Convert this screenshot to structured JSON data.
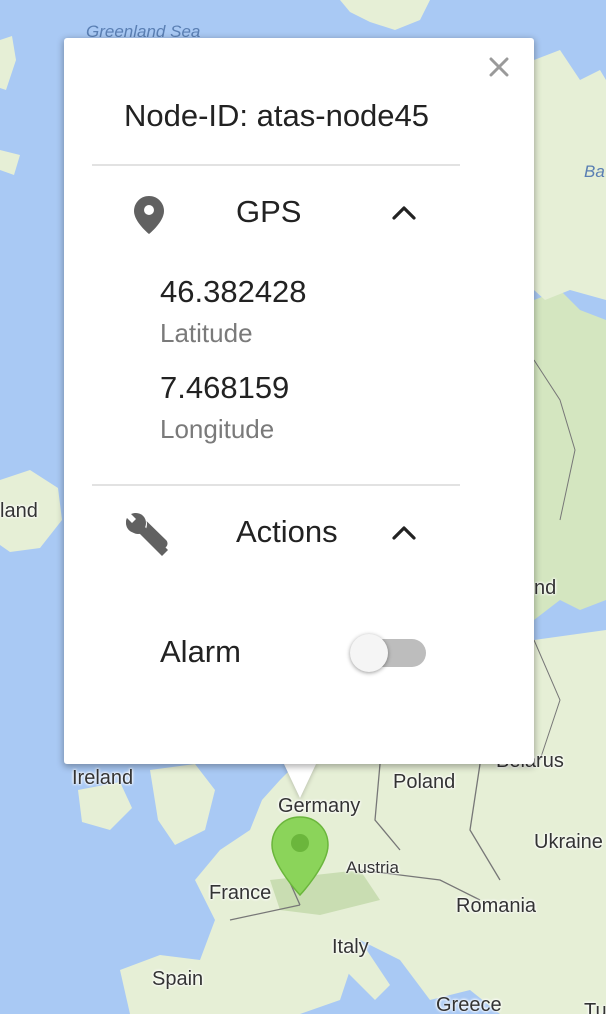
{
  "map": {
    "labels": {
      "greenland_sea": "Greenland Sea",
      "baltic": "Ba",
      "iceland": "land",
      "finland": "nd",
      "belarus": "Belarus",
      "ireland": "Ireland",
      "poland": "Poland",
      "germany": "Germany",
      "ukraine": "Ukraine",
      "austria": "Austria",
      "france": "France",
      "romania": "Romania",
      "italy": "Italy",
      "spain": "Spain",
      "greece": "Greece",
      "turkey": "Tu"
    },
    "marker_color": "#8bd45a",
    "water_color": "#a9c9f4",
    "land_color": "#e6efd6"
  },
  "popup": {
    "title": "Node-ID: atas-node45",
    "close_icon": "close-icon",
    "gps": {
      "icon": "location-pin-icon",
      "title": "GPS",
      "latitude_value": "46.382428",
      "latitude_label": "Latitude",
      "longitude_value": "7.468159",
      "longitude_label": "Longitude",
      "expanded": true
    },
    "actions": {
      "icon": "wrench-icon",
      "title": "Actions",
      "alarm_label": "Alarm",
      "alarm_on": false,
      "expanded": true
    }
  }
}
